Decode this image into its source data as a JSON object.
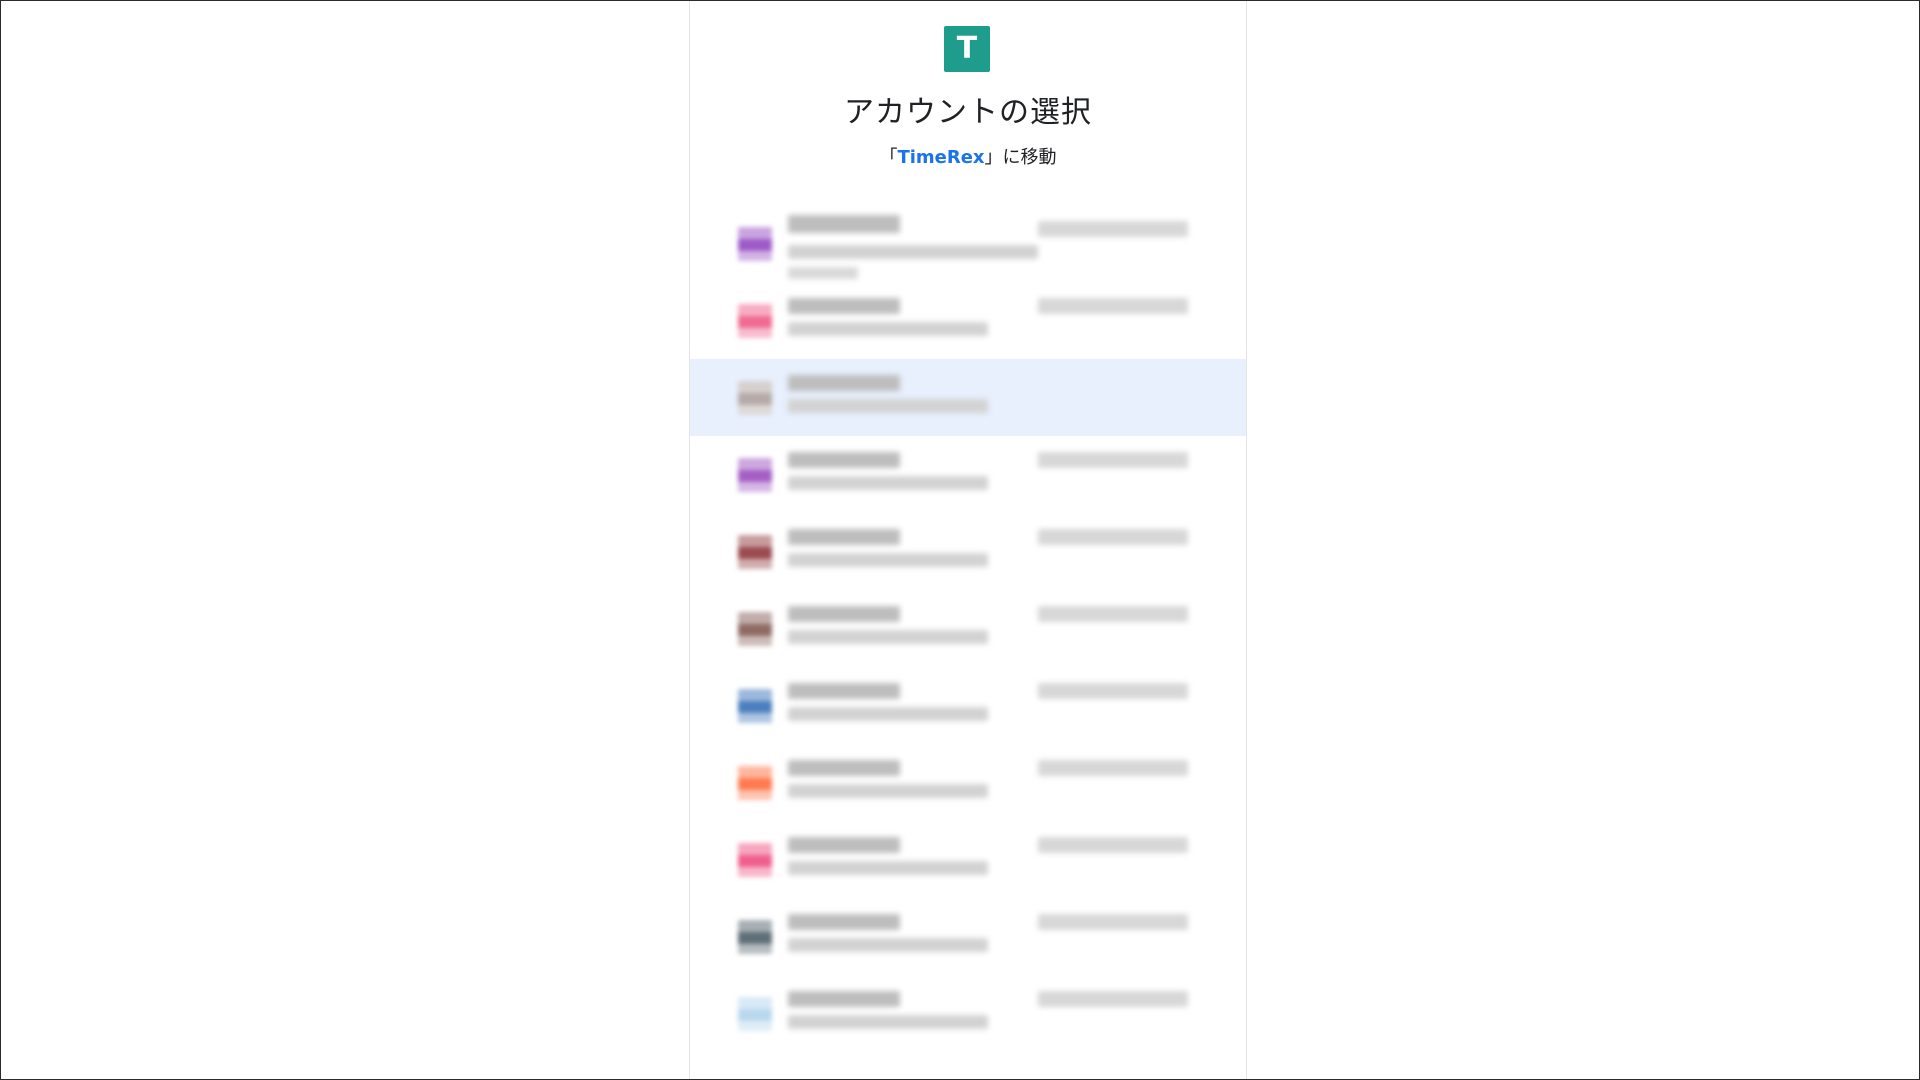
{
  "app": {
    "logo_letter": "T",
    "title": "アカウントの選択",
    "subtitle_open": "「",
    "subtitle_brand": "TimeRex",
    "subtitle_close": "」に移動"
  },
  "accounts": [
    {
      "color": "#9d5ac8",
      "selected": false
    },
    {
      "color": "#f06a92",
      "selected": false
    },
    {
      "color": "#b5aaa7",
      "selected": true
    },
    {
      "color": "#a45fc5",
      "selected": false
    },
    {
      "color": "#9b4b4f",
      "selected": false
    },
    {
      "color": "#8f6b64",
      "selected": false
    },
    {
      "color": "#4c7fbf",
      "selected": false
    },
    {
      "color": "#ff7a4f",
      "selected": false
    },
    {
      "color": "#f05f8d",
      "selected": false
    },
    {
      "color": "#5f6e77",
      "selected": false
    },
    {
      "color": "#b9d8ee",
      "selected": false
    }
  ]
}
